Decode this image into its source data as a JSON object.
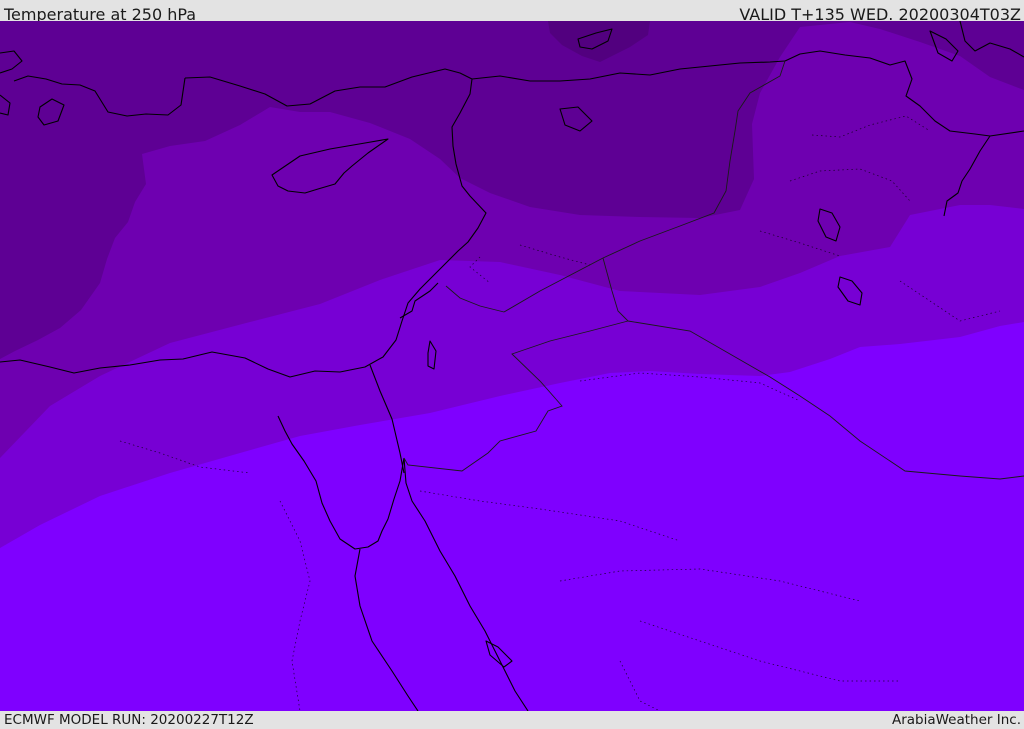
{
  "header": {
    "title": "Temperature at 250 hPa",
    "valid_time": "VALID T+135 WED. 20200304T03Z"
  },
  "footer": {
    "model_run": "ECMWF MODEL RUN: 20200227T12Z",
    "credit": "ArabiaWeather Inc."
  },
  "map": {
    "projection": "regional lat/lon view of the Eastern Mediterranean and Middle East",
    "field": "temperature",
    "level": "250 hPa",
    "legend_shown": false,
    "colors": {
      "band_coldest": "#5e0094",
      "band_cold": "#6e00b0",
      "band_mid": "#7700d4",
      "band_warm": "#7f00ff",
      "coastline": "#000000",
      "border": "#1a1a1a",
      "header_background": "#e3e3e3"
    }
  }
}
